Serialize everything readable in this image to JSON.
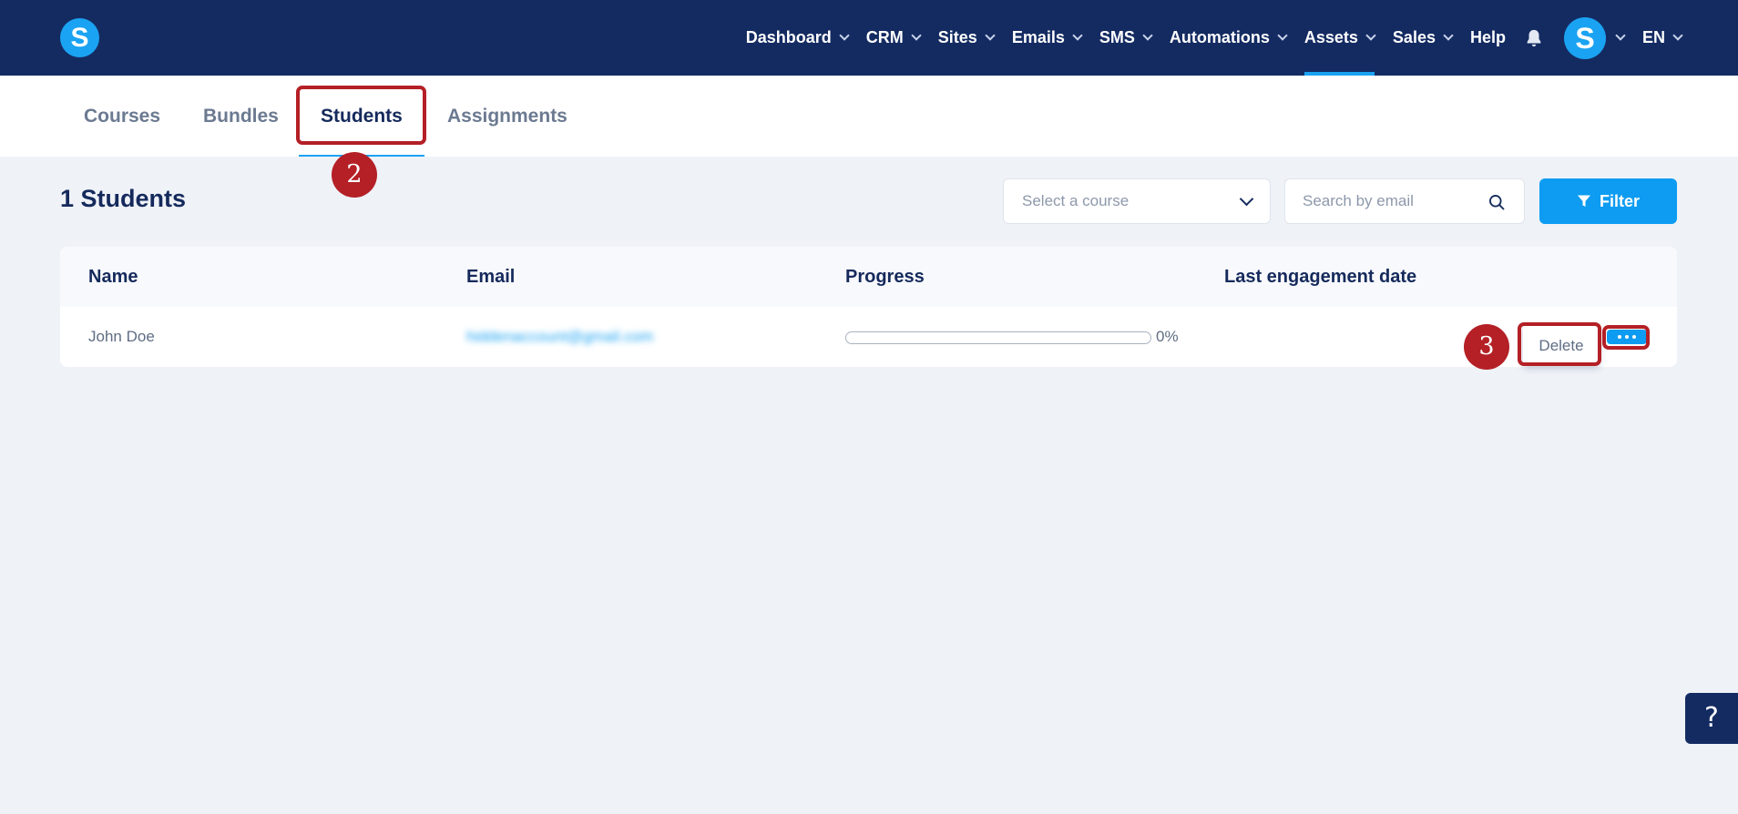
{
  "nav": {
    "logo_letter": "S",
    "items": [
      {
        "label": "Dashboard",
        "has_dropdown": true
      },
      {
        "label": "CRM",
        "has_dropdown": true
      },
      {
        "label": "Sites",
        "has_dropdown": true
      },
      {
        "label": "Emails",
        "has_dropdown": true
      },
      {
        "label": "SMS",
        "has_dropdown": true
      },
      {
        "label": "Automations",
        "has_dropdown": true
      },
      {
        "label": "Assets",
        "has_dropdown": true,
        "active": true
      },
      {
        "label": "Sales",
        "has_dropdown": true
      },
      {
        "label": "Help",
        "has_dropdown": false
      }
    ],
    "avatar_letter": "S",
    "language": "EN"
  },
  "tabs": [
    {
      "label": "Courses"
    },
    {
      "label": "Bundles"
    },
    {
      "label": "Students",
      "active": true
    },
    {
      "label": "Assignments"
    }
  ],
  "annotations": {
    "step_tab": "2",
    "step_delete": "3"
  },
  "toolbar": {
    "title": "1 Students",
    "course_select_placeholder": "Select a course",
    "search_placeholder": "Search by email",
    "filter_label": "Filter"
  },
  "table": {
    "headers": [
      "Name",
      "Email",
      "Progress",
      "Last engagement date"
    ],
    "rows": [
      {
        "name": "John Doe",
        "email": "hiddenaccount@gmail.com",
        "progress_percent": 0,
        "progress_label": "0%",
        "last_engagement": ""
      }
    ],
    "row_actions": {
      "delete_label": "Delete"
    }
  },
  "help_button": "?",
  "colors": {
    "nav_bg": "#142b62",
    "accent": "#1aa3f2",
    "annotation_red": "#b42026",
    "page_bg": "#eff2f7"
  }
}
